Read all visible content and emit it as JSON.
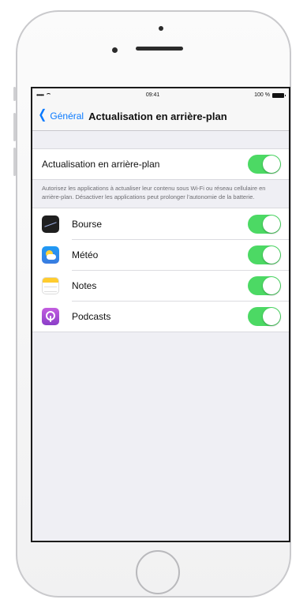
{
  "status_bar": {
    "signal": "•••••",
    "time": "09:41",
    "battery": "100 %"
  },
  "navbar": {
    "back_label": "Général",
    "title": "Actualisation en arrière-plan"
  },
  "master": {
    "label": "Actualisation en arrière-plan",
    "enabled": true
  },
  "footer_text": "Autorisez les applications à actualiser leur contenu sous Wi-Fi ou réseau cellulaire en arrière-plan. Désactiver les applications peut prolonger l'autonomie de la batterie.",
  "apps": [
    {
      "name": "Bourse",
      "icon": "stocks-icon",
      "enabled": true
    },
    {
      "name": "Météo",
      "icon": "weather-icon",
      "enabled": true
    },
    {
      "name": "Notes",
      "icon": "notes-icon",
      "enabled": true
    },
    {
      "name": "Podcasts",
      "icon": "podcasts-icon",
      "enabled": true
    }
  ],
  "colors": {
    "accent": "#0a7aff",
    "toggle_on": "#4cd964",
    "background": "#efeff4"
  }
}
